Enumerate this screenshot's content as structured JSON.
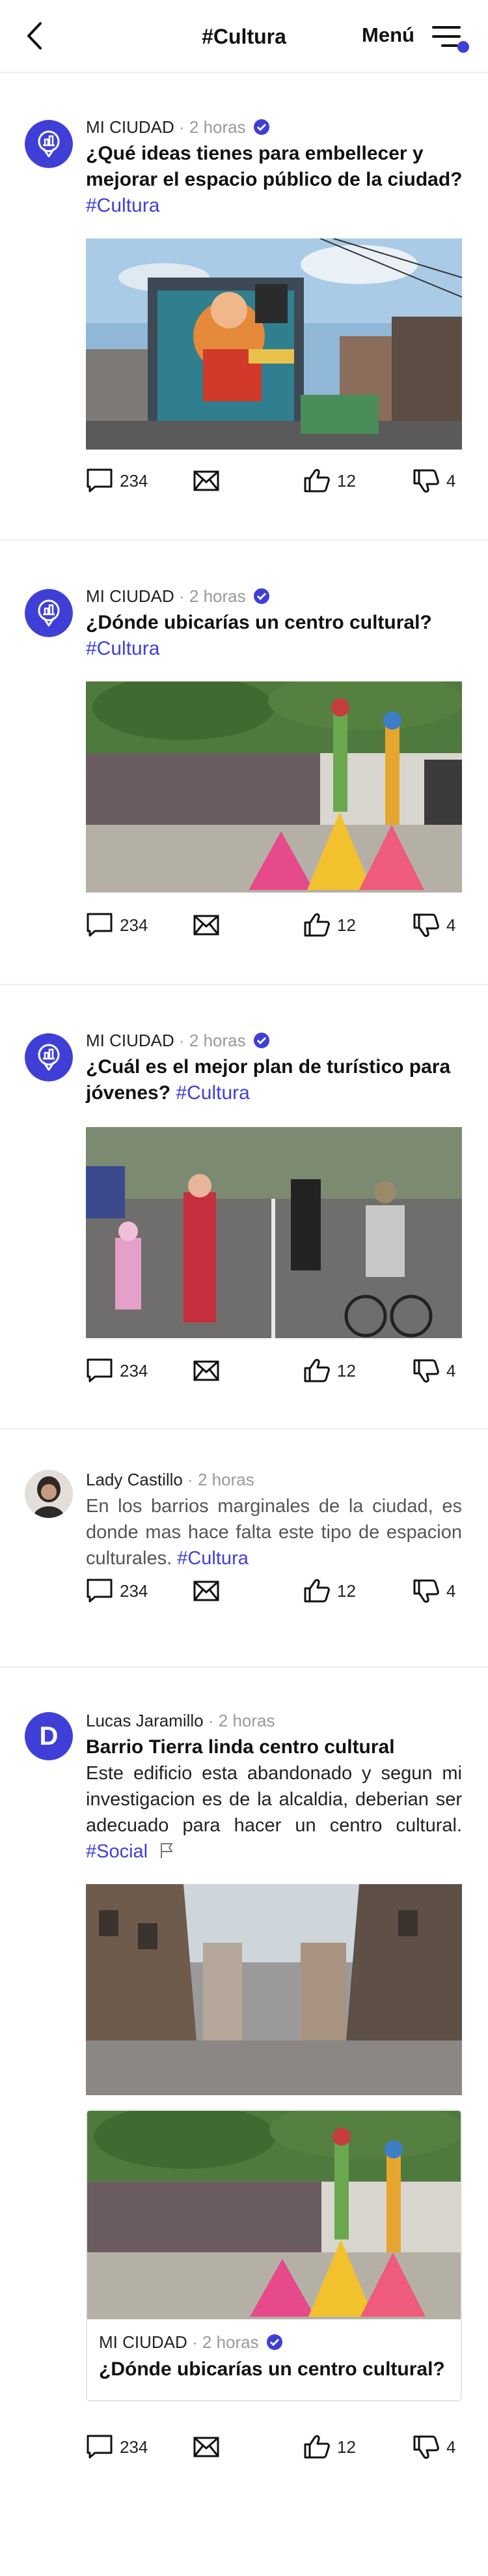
{
  "header": {
    "title": "#Cultura",
    "menu_label": "Menú"
  },
  "posts": [
    {
      "author": "MI CIUDAD",
      "time": "· 2 horas",
      "title": "¿Qué ideas tienes para embellecer y mejorar el espacio público de la ciudad?",
      "tag": "#Cultura",
      "comments": "234",
      "likes": "12",
      "dislikes": "4"
    },
    {
      "author": "MI CIUDAD",
      "time": "· 2 horas",
      "title": "¿Dónde ubicarías un centro cultural?",
      "tag": "#Cultura",
      "comments": "234",
      "likes": "12",
      "dislikes": "4"
    },
    {
      "author": "MI CIUDAD",
      "time": "· 2 horas",
      "title": "¿Cuál es el mejor plan de turístico para jóvenes?",
      "tag": "#Cultura",
      "comments": "234",
      "likes": "12",
      "dislikes": "4"
    },
    {
      "author": "Lady Castillo",
      "time": "· 2 horas",
      "body": "En los barrios marginales de la ciudad, es donde mas hace falta este tipo de espacion culturales.",
      "tag": "#Cultura",
      "comments": "234",
      "likes": "12",
      "dislikes": "4"
    },
    {
      "author": "Lucas Jaramillo",
      "avatar_letter": "D",
      "time": "· 2 horas",
      "title": "Barrio Tierra linda centro cultural",
      "body": "Este edificio esta abandonado y segun mi investigacion es de la alcaldia, deberian ser adecuado para hacer un centro cultural.",
      "tag": "#Social",
      "quoted": {
        "author": "MI CIUDAD",
        "time": "· 2 horas",
        "title": "¿Dónde ubicarías un centro cultural?"
      },
      "comments": "234",
      "likes": "12",
      "dislikes": "4"
    }
  ],
  "colors": {
    "accent": "#3f3fd8",
    "text_muted": "#999999"
  },
  "icons": [
    "back-arrow-icon",
    "menu-icon",
    "city-icon",
    "verified-icon",
    "comment-icon",
    "share-mail-icon",
    "like-icon",
    "dislike-icon",
    "flag-icon"
  ]
}
